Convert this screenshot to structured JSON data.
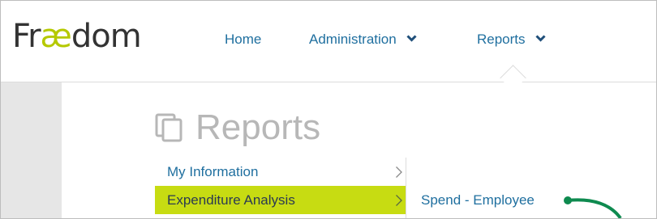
{
  "app": {
    "logo_prefix": "Fr",
    "logo_ae": "æ",
    "logo_suffix": "dom"
  },
  "nav": [
    {
      "label": "Home"
    },
    {
      "label": "Administration"
    },
    {
      "label": "Reports"
    }
  ],
  "page": {
    "title": "Reports"
  },
  "menu": [
    {
      "label": "My Information",
      "active": false
    },
    {
      "label": "Expenditure Analysis",
      "active": true
    }
  ],
  "submenu": [
    {
      "label": "Spend - Employee"
    }
  ],
  "colors": {
    "brand_ae": "#b5c900",
    "link": "#1f6f9f",
    "highlight": "#c7dc12",
    "annotation": "#0e8a4f"
  }
}
